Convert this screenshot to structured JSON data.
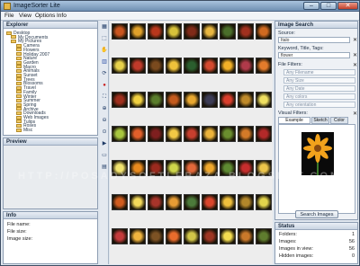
{
  "window": {
    "title": "ImageSorter Lite"
  },
  "menu": [
    "File",
    "View",
    "Options",
    "Info"
  ],
  "explorer": {
    "title": "Explorer",
    "items": [
      "Desktop",
      "My Documents",
      "My Pictures",
      "Camera",
      "Flowers",
      "Holiday 2007",
      "Nature",
      "Garden",
      "Macro",
      "Animals",
      "Sunset",
      "Trees",
      "Blossoms",
      "Travel",
      "Family",
      "Winter",
      "Summer",
      "Spring",
      "Archive",
      "Downloads",
      "Web Images",
      "Tulips",
      "Roses",
      "Misc"
    ]
  },
  "preview": {
    "title": "Preview"
  },
  "info": {
    "title": "Info",
    "rows": [
      "File name:",
      "File size:",
      "Image size:"
    ]
  },
  "toolbar": {
    "icons": [
      "sort-similarity-icon",
      "select-icon",
      "pan-icon",
      "color-swatch-icon",
      "rotate-icon",
      "red-circle-icon",
      "fit-icon",
      "zoom-in-icon",
      "zoom-out-icon",
      "zoom-reset-icon",
      "slideshow-icon",
      "display-icon",
      "folder-view-icon"
    ]
  },
  "thumb_colors": [
    "#c9551f",
    "#e0a12a",
    "#b8371c",
    "#d8c23a",
    "#7f2a18",
    "#e8b640",
    "#4a6e2a",
    "#a0301e",
    "#d06a20",
    "#e8d24a",
    "#c03a2a",
    "#7a4a1e",
    "#efc13a",
    "#2b5e2e",
    "#d4492f",
    "#f1b027",
    "#b03a4a",
    "#e37b2b",
    "#9e2f1d",
    "#f0d040",
    "#5a7d2c",
    "#c45a1c",
    "#e9a830",
    "#3c3c55",
    "#d93e2c",
    "#bf8a2a",
    "#f0e060",
    "#a8c63e",
    "#e15f2a",
    "#7e1f1f",
    "#f2c845",
    "#c73f2e",
    "#ecb33a",
    "#6a8e2e",
    "#d47a28",
    "#b32929",
    "#f1e36e",
    "#e88a1e",
    "#9b2a1e",
    "#cfd74a",
    "#e2683a",
    "#f0a82c",
    "#5e8a32",
    "#c52d2d",
    "#ecc54a",
    "#d05c1e",
    "#f3d95a",
    "#a7342a",
    "#e79c34",
    "#4c7a3a",
    "#d9462c",
    "#efbf3c",
    "#b2862a",
    "#e3d44c",
    "#c43b3b",
    "#f0b43e",
    "#7c5224",
    "#e86c2c",
    "#d1c648",
    "#9e3622",
    "#f4dd50",
    "#c9782a",
    "#5f7c2e"
  ],
  "search": {
    "title": "Image Search",
    "source_label": "Source:",
    "source_value": "Italo",
    "keyword_label": "Keyword, Title, Tags:",
    "keyword_value": "flower",
    "file_filters_label": "File Filters:",
    "filter_options": [
      "Any Filename",
      "Any Size",
      "Any Date",
      "Any colors",
      "Any orientation"
    ],
    "visual_filters_label": "Visual Filters:",
    "tabs": [
      "Example Images",
      "Sketch",
      "Color"
    ],
    "button": "Search Images"
  },
  "status": {
    "title": "Status",
    "rows": [
      {
        "label": "Folders:",
        "value": "1"
      },
      {
        "label": "Images:",
        "value": "56"
      },
      {
        "label": "Images in view:",
        "value": "56"
      },
      {
        "label": "Hidden images:",
        "value": "0"
      }
    ]
  },
  "watermark": "HTTP://POSADYSOFTLEBAZA.BLOGSPOT.COM"
}
